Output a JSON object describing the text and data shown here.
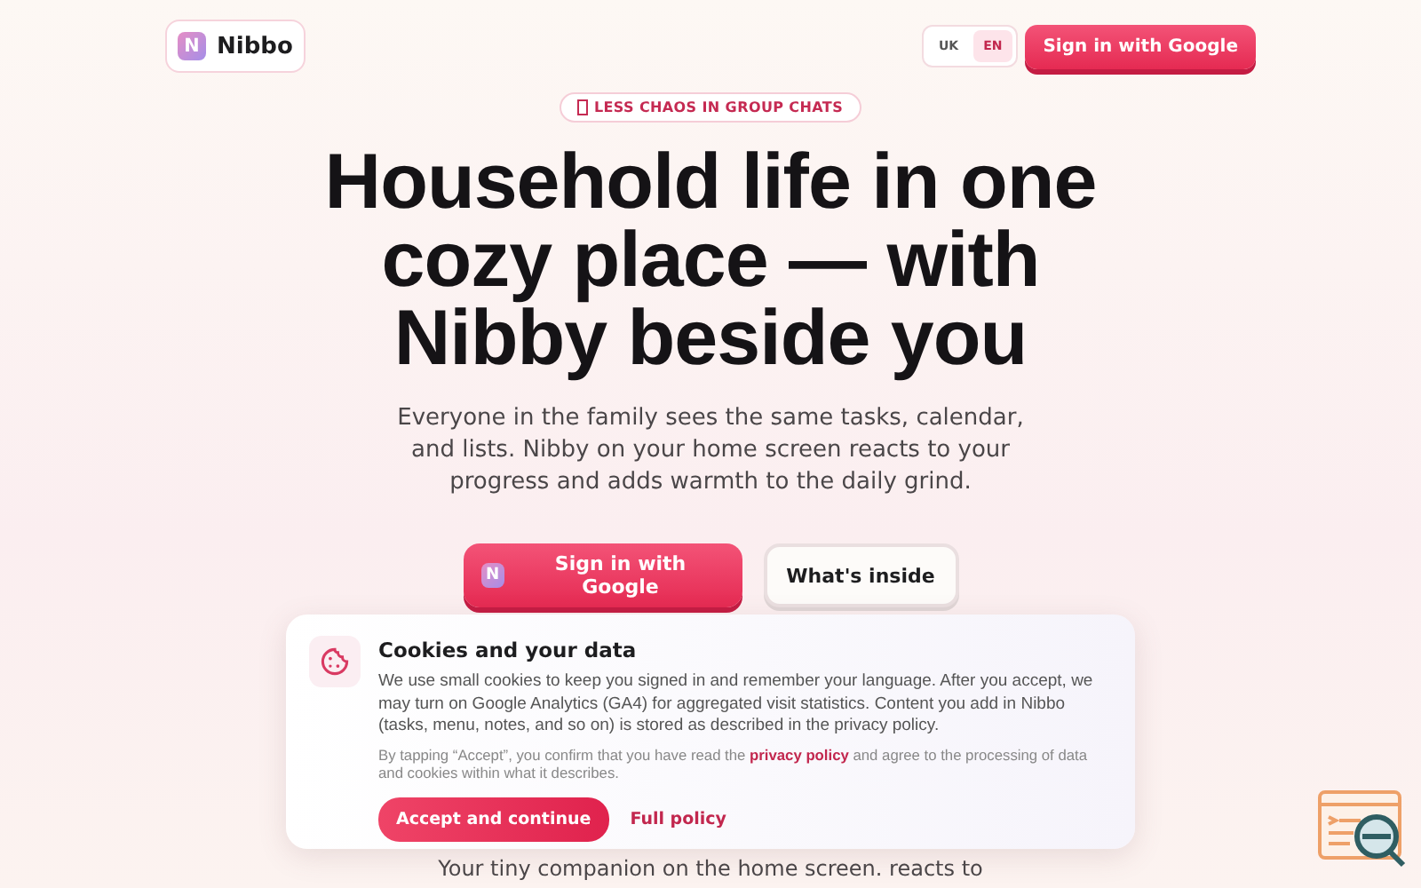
{
  "header": {
    "logo_letter": "N",
    "brand": "Nibbo",
    "languages": [
      {
        "label": "UK",
        "selected": false
      },
      {
        "label": "EN",
        "selected": true
      }
    ],
    "sign_in": "Sign in with Google"
  },
  "hero": {
    "badge": "LESS CHAOS IN GROUP CHATS",
    "title_lines": [
      "Household life in one",
      "cozy place — with",
      "Nibby beside you"
    ],
    "subtitle": "Everyone in the family sees the same tasks, calendar, and lists. Nibby on your home screen reacts to your progress and adds warmth to the daily grind.",
    "primary_button": {
      "logo_letter": "N",
      "label": "Sign in with Google"
    },
    "secondary_button": "What's inside",
    "below_text": "Your tiny companion on the home screen. reacts to"
  },
  "cookie_banner": {
    "title": "Cookies and your data",
    "body": "We use small cookies to keep you signed in and remember your language. After you accept, we may turn on Google Analytics (GA4) for aggregated visit statistics. Content you add in Nibbo (tasks, menu, notes, and so on) is stored as described in the privacy policy.",
    "note_before": "By tapping “Accept”, you confirm that you have read the",
    "note_link": "privacy policy",
    "note_after": "and agree to the processing of data and cookies within what it describes.",
    "accept": "Accept and continue",
    "full_policy": "Full policy"
  }
}
